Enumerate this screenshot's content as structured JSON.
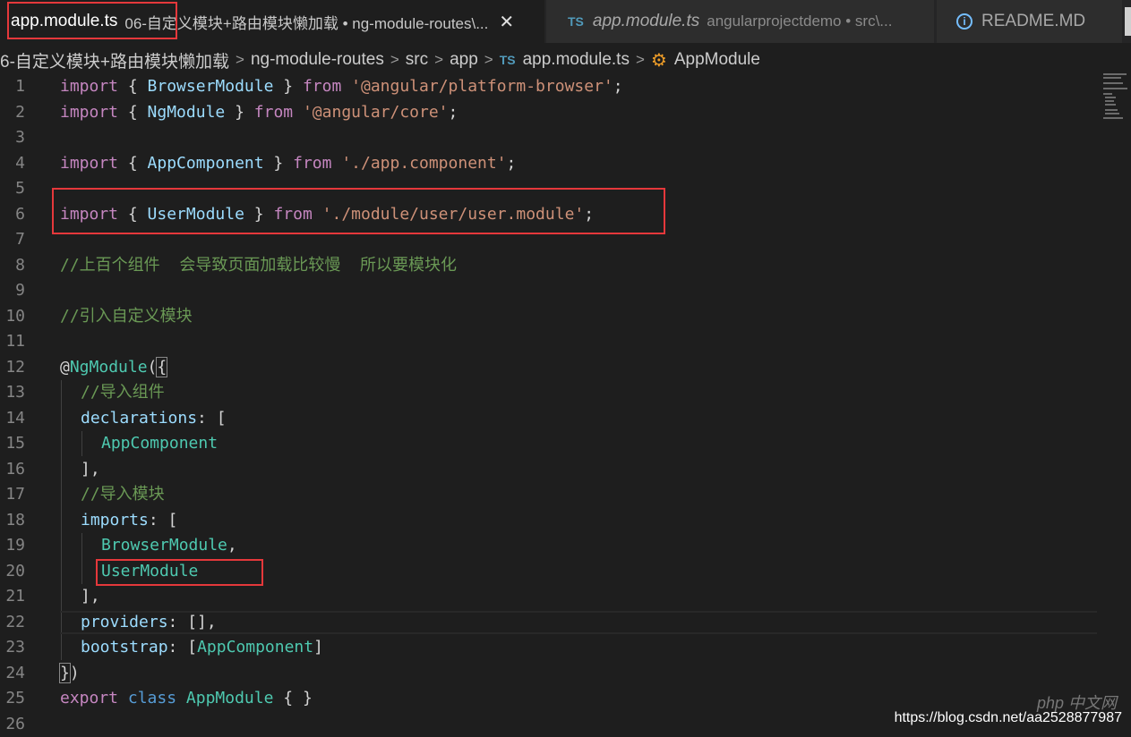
{
  "tabs": [
    {
      "name": "app.module.ts",
      "description": "06-自定义模块+路由模块懒加载 • ng-module-routes\\...",
      "close": "✕"
    },
    {
      "badge": "TS",
      "name": "app.module.ts",
      "description": "angularprojectdemo • src\\..."
    },
    {
      "name": "README.MD"
    }
  ],
  "breadcrumb": {
    "items": [
      "6-自定义模块+路由模块懒加载",
      "ng-module-routes",
      "src",
      "app"
    ],
    "file_badge": "TS",
    "file": "app.module.ts",
    "symbol": "AppModule",
    "separator": ">"
  },
  "editor": {
    "line_numbers": [
      "1",
      "2",
      "3",
      "4",
      "5",
      "6",
      "7",
      "8",
      "9",
      "10",
      "11",
      "12",
      "13",
      "14",
      "15",
      "16",
      "17",
      "18",
      "19",
      "20",
      "21",
      "22",
      "23",
      "24",
      "25",
      "26"
    ],
    "code": {
      "l1": {
        "kw": "import",
        "open": " { ",
        "name": "BrowserModule",
        "close": " } ",
        "from": "from",
        "sp": " ",
        "str": "'@angular/platform-browser'",
        "end": ";"
      },
      "l2": {
        "kw": "import",
        "open": " { ",
        "name": "NgModule",
        "close": " } ",
        "from": "from",
        "sp": " ",
        "str": "'@angular/core'",
        "end": ";"
      },
      "l4": {
        "kw": "import",
        "open": " { ",
        "name": "AppComponent",
        "close": " } ",
        "from": "from",
        "sp": " ",
        "str": "'./app.component'",
        "end": ";"
      },
      "l6": {
        "kw": "import",
        "open": " { ",
        "name": "UserModule",
        "close": " } ",
        "from": "from",
        "sp": " ",
        "str": "'./module/user/user.module'",
        "end": ";"
      },
      "l8": "//上百个组件  会导致页面加载比较慢  所以要模块化",
      "l10": "//引入自定义模块",
      "l12": {
        "at": "@",
        "deco": "NgModule",
        "paren": "(",
        "brace": "{"
      },
      "l13": "//导入组件",
      "l14": {
        "prop": "declarations",
        "rest": ": ["
      },
      "l15": "AppComponent",
      "l16": "],",
      "l17": "//导入模块",
      "l18": {
        "prop": "imports",
        "rest": ": ["
      },
      "l19": {
        "name": "BrowserModule",
        "end": ","
      },
      "l20": "UserModule",
      "l21": "],",
      "l22": {
        "prop": "providers",
        "rest": ": [],"
      },
      "l23": {
        "prop": "bootstrap",
        "open": ": [",
        "name": "AppComponent",
        "close": "]"
      },
      "l24": {
        "brace": "}",
        "paren": ")"
      },
      "l25": {
        "kw": "export",
        "kw2": "class",
        "name": "AppModule",
        "rest": " { }"
      }
    }
  },
  "watermark": {
    "url": "https://blog.csdn.net/aa2528877987",
    "logo": "php 中文网"
  },
  "colors": {
    "highlight_box": "#e5383b",
    "background": "#1e1e1e"
  }
}
